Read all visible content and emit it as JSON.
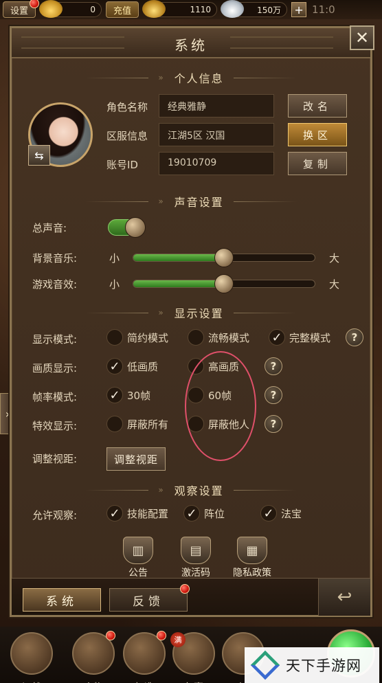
{
  "topbar": {
    "settings_label": "设置",
    "ingot_count": "0",
    "recharge_label": "充值",
    "gold_count": "1110",
    "silver_count": "150万",
    "plus": "+",
    "clock": "11:0"
  },
  "panel": {
    "title": "系统",
    "close_symbol": "✕"
  },
  "personal": {
    "heading": "个人信息",
    "rows": [
      {
        "label": "角色名称",
        "value": "经典雅静",
        "button": "改名"
      },
      {
        "label": "区服信息",
        "value": "江湖5区 汉国",
        "button": "换区"
      },
      {
        "label": "账号ID",
        "value": "19010709",
        "button": "复制"
      }
    ],
    "swap_symbol": "⇆"
  },
  "sound": {
    "heading": "声音设置",
    "master_label": "总声音:",
    "master_on": true,
    "bgm_label": "背景音乐:",
    "sfx_label": "游戏音效:",
    "small": "小",
    "big": "大",
    "bgm_level": 0.5,
    "sfx_level": 0.5
  },
  "display": {
    "heading": "显示设置",
    "mode_label": "显示模式:",
    "mode_options": [
      "简约模式",
      "流畅模式",
      "完整模式"
    ],
    "mode_selected": 2,
    "quality_label": "画质显示:",
    "quality_options": [
      "低画质",
      "高画质"
    ],
    "quality_selected": 0,
    "fps_label": "帧率模式:",
    "fps_options": [
      "30帧",
      "60帧"
    ],
    "fps_selected": 0,
    "effects_label": "特效显示:",
    "effects_options": [
      "屏蔽所有",
      "屏蔽他人"
    ],
    "view_label": "调整视距:",
    "view_button": "调整视距",
    "help": "?",
    "check": "✓"
  },
  "observe": {
    "heading": "观察设置",
    "allow_label": "允许观察:",
    "options": [
      "技能配置",
      "阵位",
      "法宝"
    ]
  },
  "links": [
    {
      "label": "公告"
    },
    {
      "label": "激活码"
    },
    {
      "label": "隐私政策"
    }
  ],
  "tabs": {
    "system": "系统",
    "feedback": "反馈"
  },
  "side_arrow": "›",
  "game_menu": [
    {
      "label": "证战"
    },
    {
      "label": "人物"
    },
    {
      "label": "打造"
    },
    {
      "label": "包裹"
    },
    {
      "label": "社"
    }
  ],
  "full_badge": "满",
  "watermark": "天下手游网",
  "colors": {
    "panel_bg": "#3d2c1e",
    "accent_gold": "#c08a38",
    "toggle_green": "#5ca83a",
    "annotation": "#e0506a"
  }
}
